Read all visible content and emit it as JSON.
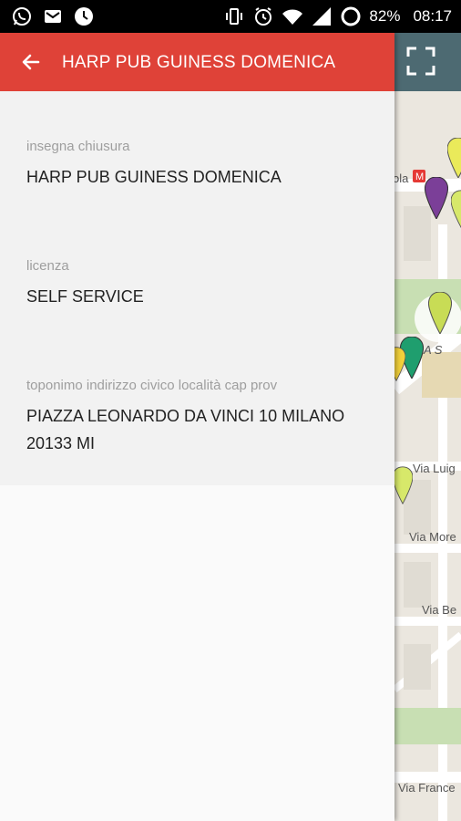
{
  "status_bar": {
    "battery": "82%",
    "time": "08:17",
    "left_icons": [
      "whatsapp-icon",
      "mail-icon",
      "clock-app-icon"
    ],
    "right_icons": [
      "vibrate-icon",
      "alarm-icon",
      "wifi-icon",
      "signal-icon",
      "battery-icon"
    ]
  },
  "app_bar": {
    "title": "HARP PUB GUINESS DOMENICA",
    "color": "#df4238",
    "back_icon": "arrow-back-icon"
  },
  "details": [
    {
      "label": "insegna chiusura",
      "value": "HARP PUB GUINESS DOMENICA"
    },
    {
      "label": "licenza",
      "value": "SELF SERVICE"
    },
    {
      "label": "toponimo indirizzo civico località cap prov",
      "value": "PIAZZA LEONARDO DA VINCI 10 MILANO 20133 MI"
    }
  ],
  "map": {
    "fullscreen_icon": "fullscreen-icon",
    "labels": [
      "ola",
      "A S",
      "Via Luig",
      "Via More",
      "Via Be",
      "Via France"
    ],
    "marker_colors": [
      "#e8e84a",
      "#7b3f98",
      "#d7e86a",
      "#1f9e6e",
      "#f2d03a"
    ]
  }
}
